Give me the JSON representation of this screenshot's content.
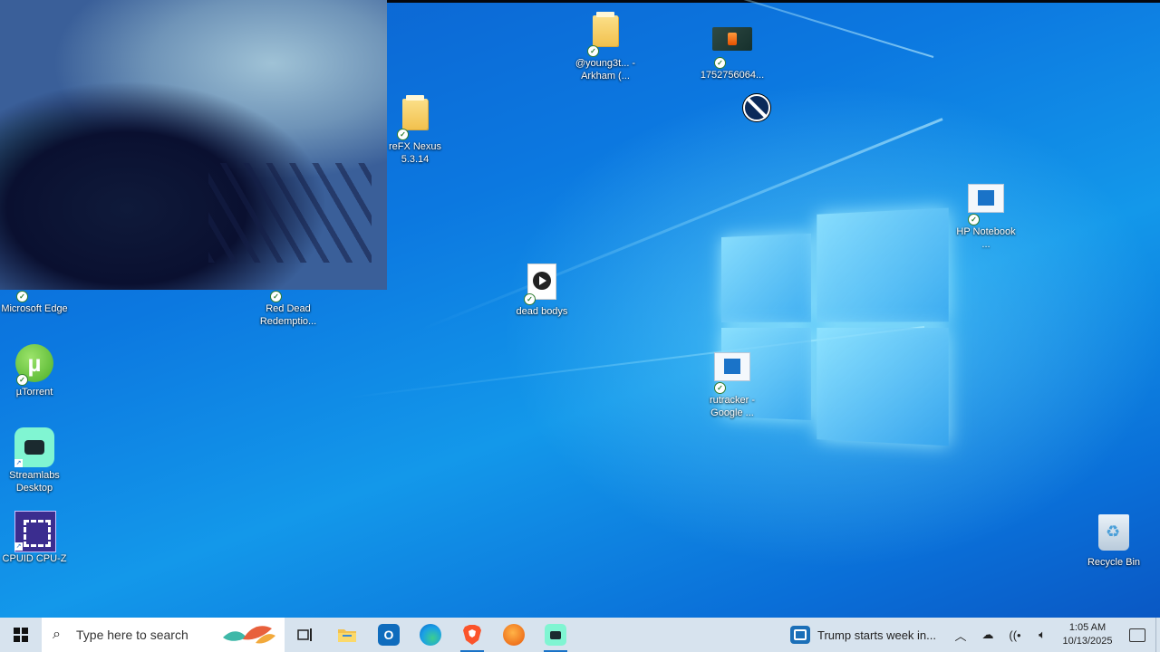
{
  "desktop": {
    "icons": [
      {
        "id": "young3t",
        "label": "@young3t... - Arkham (..."
      },
      {
        "id": "flp",
        "label": "1752756064..."
      },
      {
        "id": "refx",
        "label": "reFX Nexus 5.3.14"
      },
      {
        "id": "hp",
        "label": "HP Notebook ..."
      },
      {
        "id": "edge",
        "label": "Microsoft Edge"
      },
      {
        "id": "rdr",
        "label": "Red Dead Redemptio..."
      },
      {
        "id": "deadbodies",
        "label": "dead bodys"
      },
      {
        "id": "rutracker",
        "label": "rutracker - Google ..."
      },
      {
        "id": "utorrent",
        "label": "µTorrent"
      },
      {
        "id": "streamlabs",
        "label": "Streamlabs Desktop"
      },
      {
        "id": "cpuz",
        "label": "CPUID CPU-Z"
      },
      {
        "id": "recycle",
        "label": "Recycle Bin"
      }
    ]
  },
  "taskbar": {
    "search_placeholder": "Type here to search",
    "pinned": [
      {
        "id": "task-view",
        "icon": "task-view-icon"
      },
      {
        "id": "file-explorer",
        "icon": "folder-icon"
      },
      {
        "id": "outlook",
        "icon": "outlook-icon",
        "glyph": "O"
      },
      {
        "id": "edge",
        "icon": "edge-icon"
      },
      {
        "id": "brave",
        "icon": "brave-icon"
      },
      {
        "id": "fl-studio",
        "icon": "fl-studio-icon"
      },
      {
        "id": "streamlabs",
        "icon": "streamlabs-icon"
      }
    ],
    "news": "Trump starts week in...",
    "time": "1:05 AM",
    "date": "10/13/2025"
  },
  "colors": {
    "taskbar_bg": "#d7e3ee",
    "accent": "#1a73c8",
    "desktop_blue": "#0c78e0"
  }
}
